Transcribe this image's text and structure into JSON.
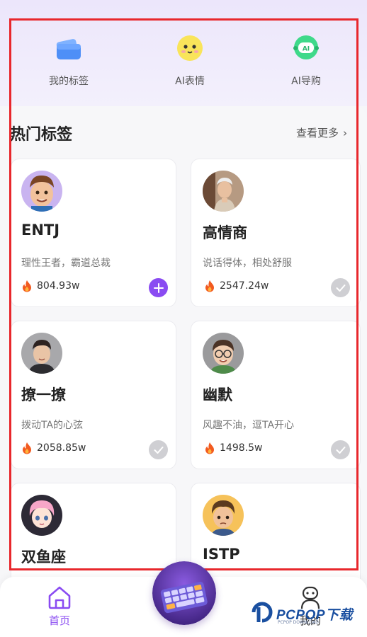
{
  "shortcuts": [
    {
      "label": "我的标签",
      "icon": "wallet-icon"
    },
    {
      "label": "AI表情",
      "icon": "emoji-face-icon"
    },
    {
      "label": "AI导购",
      "icon": "ai-robot-icon"
    }
  ],
  "hot_section": {
    "title": "热门标签",
    "more_label": "查看更多",
    "more_icon": "chevron-right-icon"
  },
  "cards": [
    {
      "name": "ENTJ",
      "desc": "理性王者，霸道总裁",
      "heat": "804.93w",
      "state": "add"
    },
    {
      "name": "高情商",
      "desc": "说话得体，相处舒服",
      "heat": "2547.24w",
      "state": "added"
    },
    {
      "name": "撩一撩",
      "desc": "拨动TA的心弦",
      "heat": "2058.85w",
      "state": "added"
    },
    {
      "name": "幽默",
      "desc": "风趣不油，逗TA开心",
      "heat": "1498.5w",
      "state": "added"
    },
    {
      "name": "双鱼座",
      "desc": "",
      "heat": "",
      "state": ""
    },
    {
      "name": "ISTP",
      "desc": "",
      "heat": "",
      "state": ""
    }
  ],
  "tabbar": {
    "home_label": "首页",
    "mine_label": "我的",
    "center_icon": "keyboard-icon"
  },
  "watermark": {
    "brand": "PCPOP下载",
    "sub": "PCPOP DOWNLOAD"
  },
  "colors": {
    "accent": "#8a4bf2",
    "highlight_frame": "#e8272c",
    "fire": "#f25a1f"
  }
}
